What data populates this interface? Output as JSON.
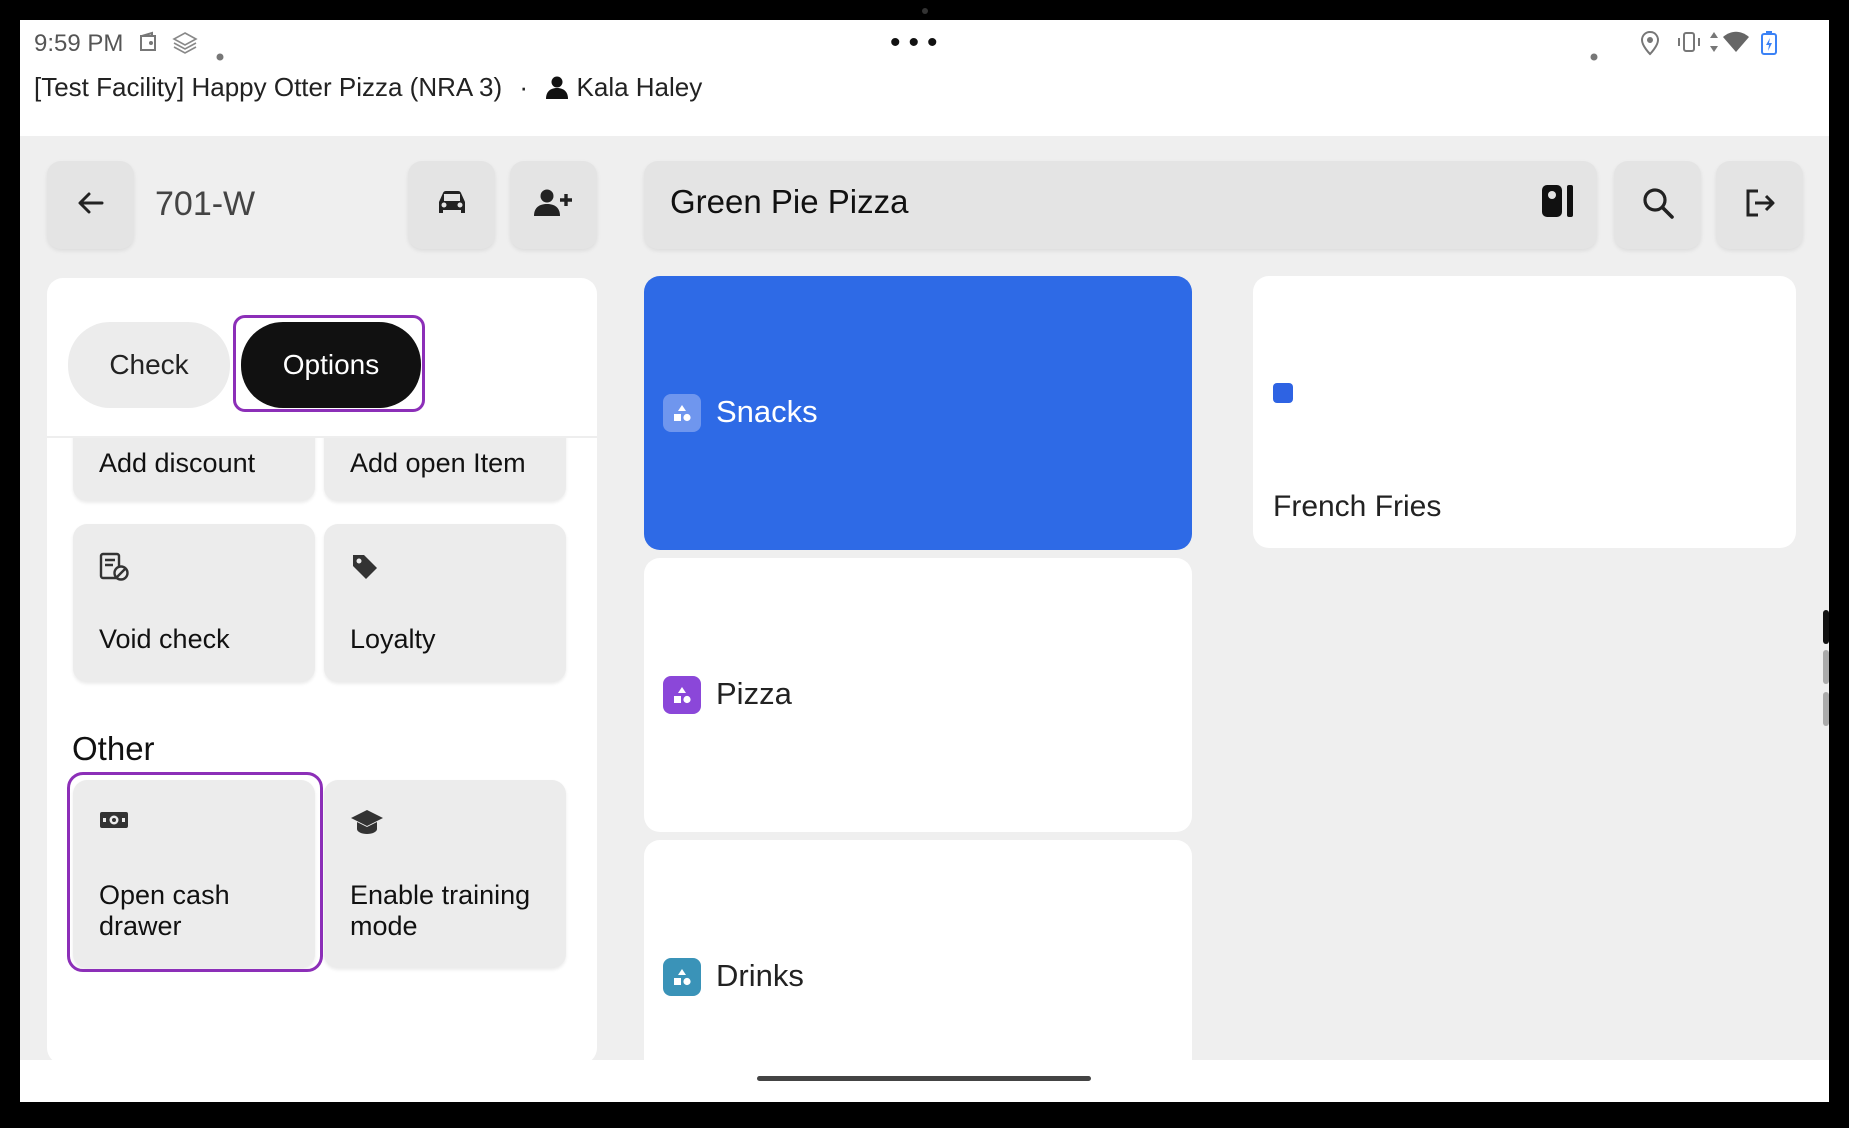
{
  "status_bar": {
    "time": "9:59 PM",
    "center_dots": "•••",
    "facility": "[Test Facility] Happy Otter Pizza (NRA 3)",
    "separator": "·",
    "user": "Kala Haley",
    "icons": [
      "wallet-icon",
      "layers-icon",
      "notification-dot-icon",
      "location-pin-icon",
      "vibrate-icon",
      "data-arrows-icon",
      "wifi-icon",
      "battery-charging-icon"
    ]
  },
  "header": {
    "back_icon": "arrow-left-icon",
    "table_name": "701-W",
    "car_icon": "car-icon",
    "add_guest_icon": "person-add-icon",
    "menu_name": "Green Pie Pizza",
    "layout_icon": "panel-toggle-icon",
    "search_icon": "search-icon",
    "exit_icon": "logout-icon"
  },
  "left_panel": {
    "tabs": [
      {
        "label": "Check",
        "selected": false
      },
      {
        "label": "Options",
        "selected": true
      }
    ],
    "actions": [
      {
        "label": "Add discount"
      },
      {
        "label": "Add open Item"
      },
      {
        "label": "Void check",
        "icon": "void-receipt-icon"
      },
      {
        "label": "Loyalty",
        "icon": "tag-icon"
      }
    ],
    "other_heading": "Other",
    "other_actions": [
      {
        "label": "Open cash drawer",
        "icon": "cash-icon"
      },
      {
        "label": "Enable training mode",
        "icon": "graduation-cap-icon"
      }
    ]
  },
  "categories": [
    {
      "name": "Snacks",
      "selected": true,
      "badge_color": "#6f96ee"
    },
    {
      "name": "Pizza",
      "selected": false,
      "badge_color": "#8b47d9"
    },
    {
      "name": "Drinks",
      "selected": false,
      "badge_color": "#3a93b8"
    }
  ],
  "items": [
    {
      "name": "French Fries",
      "color": "#2e63e3"
    }
  ],
  "colors": {
    "selected_blue": "#2e6ae6",
    "highlight_purple": "#8c2fb8"
  }
}
